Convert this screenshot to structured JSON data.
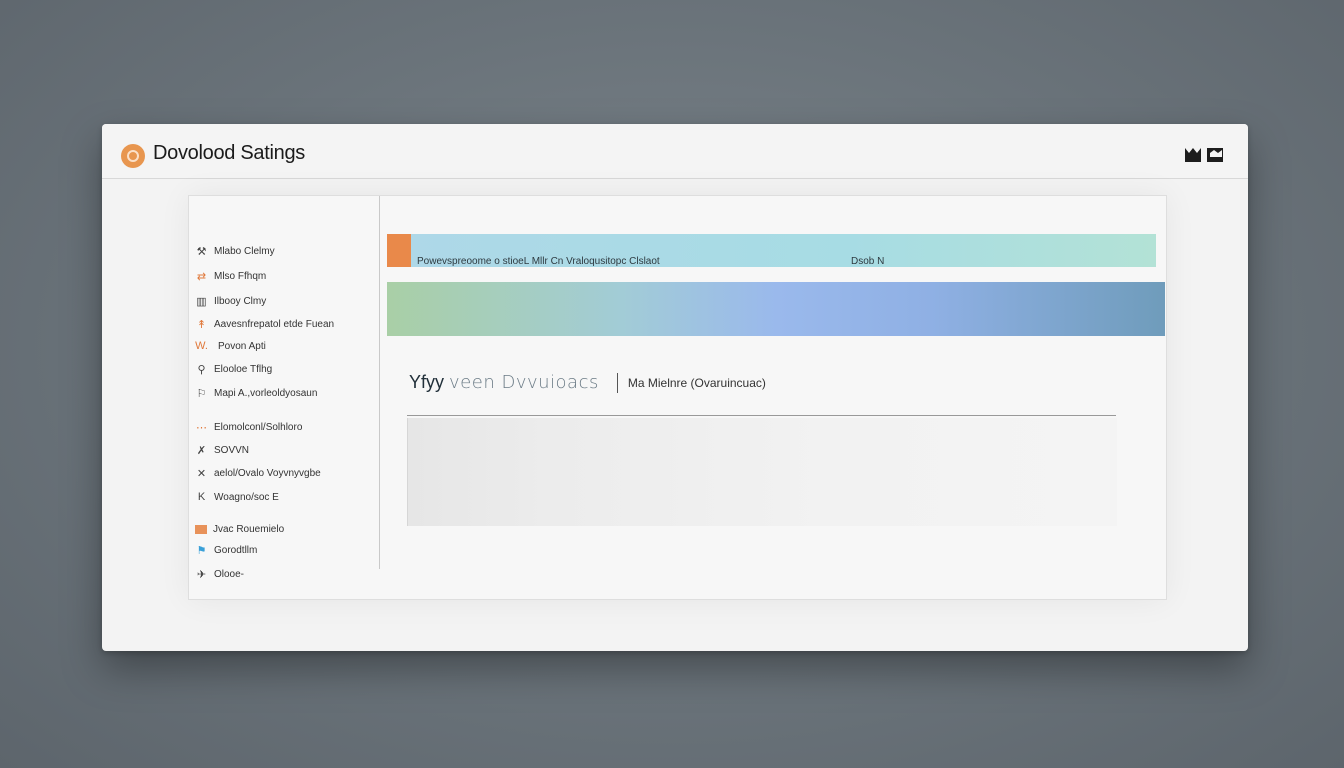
{
  "window": {
    "title": "Dovolood Satings"
  },
  "sidebar": {
    "items": [
      {
        "label": "Mlabo Clelmy",
        "icon": "tool-icon"
      },
      {
        "label": "Mlso Ffhqm",
        "icon": "transfer-icon"
      },
      {
        "label": "Ilbooy Clmy",
        "icon": "grid-icon"
      },
      {
        "label": "Aavesnfrepatol etde Fuean",
        "icon": "pin-icon"
      },
      {
        "label": "Povon Apti",
        "icon": "wave-icon"
      },
      {
        "label": "Elooloe Tflhg",
        "icon": "filter-icon"
      },
      {
        "label": "Mapi A.,vorleoldyosaun",
        "icon": "marker-icon"
      },
      {
        "label": "Elomolconl/Solhloro",
        "icon": "dots-icon"
      },
      {
        "label": "SOVVN",
        "icon": "tick-icon"
      },
      {
        "label": "aelol/Ovalo Voyvnyvgbe",
        "icon": "cross-icon"
      },
      {
        "label": "Woagno/soc E",
        "icon": "k-icon"
      },
      {
        "label": "Jvac Rouemielo",
        "icon": "folder-icon"
      },
      {
        "label": "Gorodtllm",
        "icon": "flag-icon"
      },
      {
        "label": "Olooe-",
        "icon": "plane-icon"
      }
    ]
  },
  "progress": {
    "text": "Powevspreoome o stioeL Mllr Cn Vraloqusitopc Clslaot",
    "status": "Dsob N",
    "accent_color": "#e9894a"
  },
  "heading": {
    "main": "Yfyy",
    "light": "veen Dvvuioacs",
    "sub": "Ma Mielnre (Ovaruincuac)"
  }
}
